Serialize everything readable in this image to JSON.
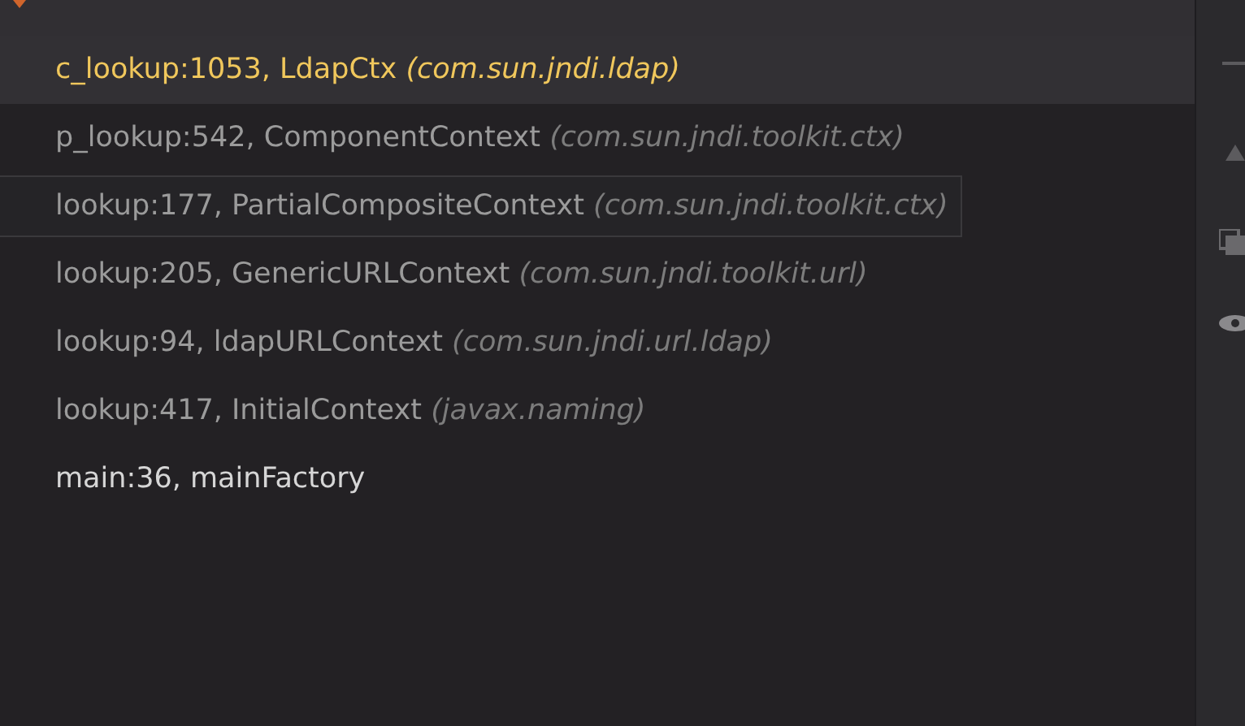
{
  "frames": [
    {
      "location": "c_lookup:1053, LdapCtx",
      "package": "(com.sun.jndi.ldap)",
      "selected": true,
      "hovered": false,
      "kind": "library"
    },
    {
      "location": "p_lookup:542, ComponentContext",
      "package": "(com.sun.jndi.toolkit.ctx)",
      "selected": false,
      "hovered": false,
      "kind": "library"
    },
    {
      "location": "lookup:177, PartialCompositeContext",
      "package": "(com.sun.jndi.toolkit.ctx)",
      "selected": false,
      "hovered": true,
      "kind": "library"
    },
    {
      "location": "lookup:205, GenericURLContext",
      "package": "(com.sun.jndi.toolkit.url)",
      "selected": false,
      "hovered": false,
      "kind": "library"
    },
    {
      "location": "lookup:94, ldapURLContext",
      "package": "(com.sun.jndi.url.ldap)",
      "selected": false,
      "hovered": false,
      "kind": "library"
    },
    {
      "location": "lookup:417, InitialContext",
      "package": "(javax.naming)",
      "selected": false,
      "hovered": false,
      "kind": "library"
    },
    {
      "location": "main:36, mainFactory",
      "selected": false,
      "hovered": false,
      "kind": "user"
    }
  ]
}
